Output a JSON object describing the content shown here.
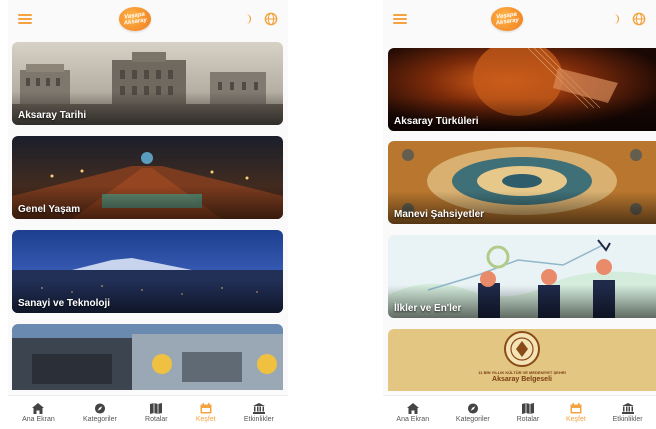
{
  "colors": {
    "accent": "#f4a340",
    "nav_text": "#555555"
  },
  "screens": [
    {
      "logo_text": "Vaşapa Aksaray",
      "cards": [
        {
          "label": "Aksaray Tarihi"
        },
        {
          "label": "Genel Yaşam"
        },
        {
          "label": "Sanayi ve Teknoloji"
        },
        {
          "label": ""
        }
      ],
      "nav": [
        {
          "label": "Ana Ekran",
          "icon": "home-icon"
        },
        {
          "label": "Kategoriler",
          "icon": "compass-icon"
        },
        {
          "label": "Rotalar",
          "icon": "map-icon"
        },
        {
          "label": "Keşfet",
          "icon": "calendar-icon",
          "active": true
        },
        {
          "label": "Etkinlikler",
          "icon": "museum-icon"
        }
      ]
    },
    {
      "logo_text": "Vaşapa Aksaray",
      "cards": [
        {
          "label": "Aksaray Türküleri"
        },
        {
          "label": "Manevi Şahsiyetler"
        },
        {
          "label": "İlkler ve En'ler"
        },
        {
          "label": "",
          "subtitle": "11 BİN YILLIK KÜLTÜR VE MEDENİYET ŞEHRİ",
          "title": "Aksaray Belgeseli"
        }
      ],
      "nav": [
        {
          "label": "Ana Ekran",
          "icon": "home-icon"
        },
        {
          "label": "Kategoriler",
          "icon": "compass-icon"
        },
        {
          "label": "Rotalar",
          "icon": "map-icon"
        },
        {
          "label": "Keşfet",
          "icon": "calendar-icon",
          "active": true
        },
        {
          "label": "Etkinlikler",
          "icon": "museum-icon"
        }
      ]
    }
  ]
}
